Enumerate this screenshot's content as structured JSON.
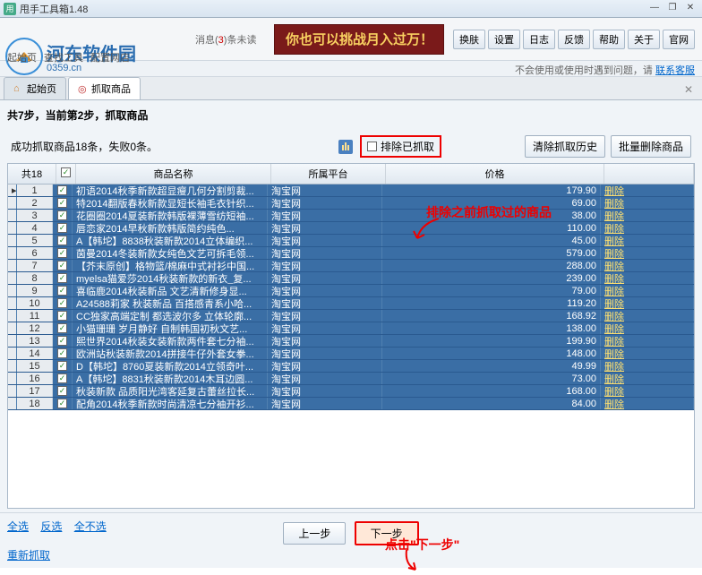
{
  "window": {
    "title": "甩手工具箱1.48",
    "min": "—",
    "restore": "❐",
    "close": "✕"
  },
  "header": {
    "logo_text": "河东软件园",
    "logo_url": "0359.cn",
    "nav": [
      "起始页",
      "查找工具",
      "配置网店"
    ],
    "msg_label": "消息(",
    "msg_count": "3",
    "msg_suffix": ")条未读",
    "banner": "你也可以挑战月入过万！",
    "buttons": [
      "换肤",
      "设置",
      "日志",
      "反馈",
      "帮助",
      "关于",
      "官网"
    ],
    "subbar_text": "不会使用或使用时遇到问题，请 ",
    "subbar_link": "联系客服"
  },
  "tabs": {
    "home_icon": "⌂",
    "home": "起始页",
    "capture_icon": "◎",
    "capture": "抓取商品"
  },
  "step": {
    "label": "共7步，当前第2步，抓取商品"
  },
  "annotations": {
    "exclude": "排除之前抓取过的商品",
    "next": "点击\"下一步\""
  },
  "status": {
    "text": "成功抓取商品18条，失败0条。"
  },
  "controls": {
    "exclude_label": "排除已抓取",
    "clear_history": "清除抓取历史",
    "batch_delete": "批量删除商品"
  },
  "grid": {
    "count_label": "共18",
    "headers": {
      "name": "商品名称",
      "platform": "所属平台",
      "price": "价格"
    },
    "delete_label": "删除",
    "rows": [
      {
        "idx": 1,
        "name": "初语2014秋季新款超显瘦几何分割剪裁...",
        "platform": "淘宝网",
        "price": "179.90"
      },
      {
        "idx": 2,
        "name": "特2014翻版春秋新款显短长袖毛衣针织...",
        "platform": "淘宝网",
        "price": "69.00"
      },
      {
        "idx": 3,
        "name": "花圈圈2014夏装新款韩版裸薄雪纺短袖...",
        "platform": "淘宝网",
        "price": "38.00"
      },
      {
        "idx": 4,
        "name": "唇恋家2014早秋新款韩版简约纯色...",
        "platform": "淘宝网",
        "price": "110.00"
      },
      {
        "idx": 5,
        "name": "A【韩坨】8838秋装新款2014立体编织...",
        "platform": "淘宝网",
        "price": "45.00"
      },
      {
        "idx": 6,
        "name": "茵曼2014冬装新款女纯色文艺可拆毛领...",
        "platform": "淘宝网",
        "price": "579.00"
      },
      {
        "idx": 7,
        "name": "【芥末原创】格物篮/棉麻中式衬衫中国...",
        "platform": "淘宝网",
        "price": "288.00"
      },
      {
        "idx": 8,
        "name": "myelsa猫爱莎2014秋装新款的新衣_复...",
        "platform": "淘宝网",
        "price": "239.00"
      },
      {
        "idx": 9,
        "name": "喜临鹿2014秋装新品 文艺清新修身显...",
        "platform": "淘宝网",
        "price": "79.00"
      },
      {
        "idx": 10,
        "name": "A24588莉家 秋装新品 百搭感青系小哈...",
        "platform": "淘宝网",
        "price": "119.20"
      },
      {
        "idx": 11,
        "name": "CC独家高端定制 都选波尔多 立体轮廓...",
        "platform": "淘宝网",
        "price": "168.92"
      },
      {
        "idx": 12,
        "name": "小猫珊珊 岁月静好 自制韩国初秋文艺...",
        "platform": "淘宝网",
        "price": "138.00"
      },
      {
        "idx": 13,
        "name": "熙世界2014秋装女装新款两件套七分袖...",
        "platform": "淘宝网",
        "price": "199.90"
      },
      {
        "idx": 14,
        "name": "欧洲站秋装新款2014拼接牛仔外套女拳...",
        "platform": "淘宝网",
        "price": "148.00"
      },
      {
        "idx": 15,
        "name": "D【韩坨】8760夏装新款2014立领奇叶...",
        "platform": "淘宝网",
        "price": "49.99"
      },
      {
        "idx": 16,
        "name": "A【韩坨】8831秋装新款2014木耳边圆...",
        "platform": "淘宝网",
        "price": "73.00"
      },
      {
        "idx": 17,
        "name": "秋装新款 品质阳光湾客延复古蕾丝拉长...",
        "platform": "淘宝网",
        "price": "168.00"
      },
      {
        "idx": 18,
        "name": "配角2014秋季新款时尚清凉七分袖开衫...",
        "platform": "淘宝网",
        "price": "84.00"
      }
    ]
  },
  "footer": {
    "select_all": "全选",
    "select_inv": "反选",
    "select_none": "全不选",
    "prev": "上一步",
    "next": "下一步",
    "redo": "重新抓取"
  }
}
